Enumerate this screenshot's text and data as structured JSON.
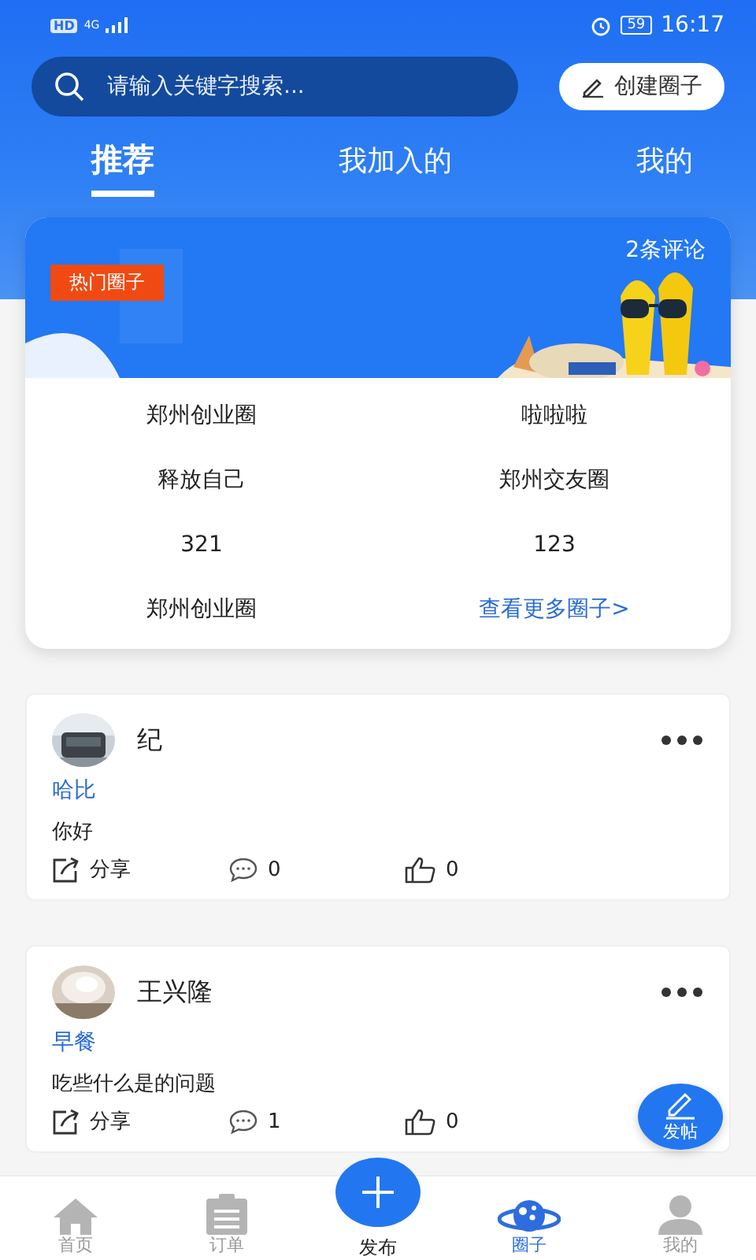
{
  "status_bar": {
    "network": "HD",
    "signal_type": "4G",
    "battery": "59",
    "time": "16:17"
  },
  "search": {
    "placeholder": "请输入关键字搜索..."
  },
  "create_button": "创建圈子",
  "tabs": [
    {
      "label": "推荐",
      "selected": true
    },
    {
      "label": "我加入的",
      "selected": false
    },
    {
      "label": "我的",
      "selected": false
    }
  ],
  "featured": {
    "badge": "热门圈子",
    "comments": "2条评论",
    "groups": [
      "郑州创业圈",
      "啦啦啦",
      "释放自己",
      "郑州交友圈",
      "321",
      "123",
      "郑州创业圈"
    ],
    "more_link": "查看更多圈子>"
  },
  "posts": [
    {
      "author": "纪",
      "circle": "哈比",
      "text": "你好",
      "share": "分享",
      "comments": "0",
      "likes": "0"
    },
    {
      "author": "王兴隆",
      "circle": "早餐",
      "text": "吃些什么是的问题",
      "share": "分享",
      "comments": "1",
      "likes": "0"
    }
  ],
  "fab": "发帖",
  "nav": [
    {
      "kind": "home",
      "label": "首页",
      "selected": false
    },
    {
      "kind": "orders",
      "label": "订单",
      "selected": false
    },
    {
      "kind": "publish",
      "label": "发布",
      "selected": false
    },
    {
      "kind": "circle",
      "label": "圈子",
      "selected": true
    },
    {
      "kind": "profile",
      "label": "我的",
      "selected": false
    }
  ]
}
